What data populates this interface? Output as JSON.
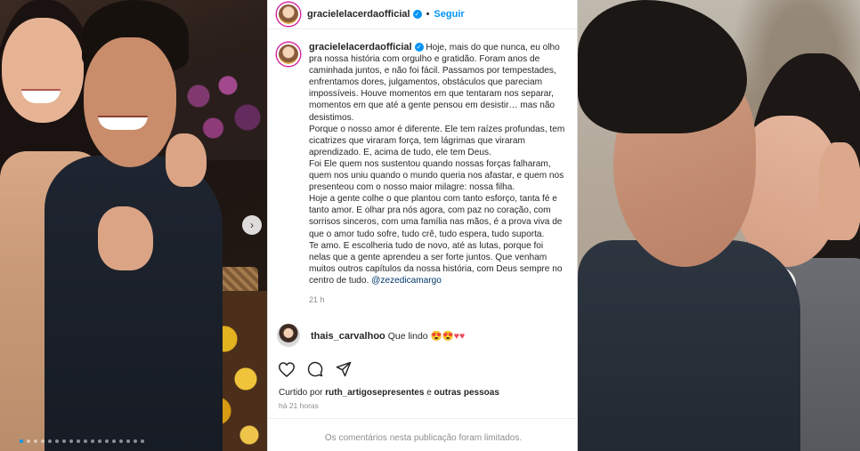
{
  "post": {
    "username": "gracielelacerdaofficial",
    "verified_badge": "✓",
    "separator": "•",
    "follow_label": "Seguir",
    "caption_paragraphs": [
      "Hoje, mais do que nunca, eu olho pra nossa história com orgulho e gratidão. Foram anos de caminhada juntos, e não foi fácil. Passamos por tempestades, enfrentamos dores, julgamentos, obstáculos que pareciam impossíveis. Houve momentos em que tentaram nos separar, momentos em que até a gente pensou em desistir… mas não desistimos.",
      "Porque o nosso amor é diferente. Ele tem raízes profundas, tem cicatrizes que viraram força, tem lágrimas que viraram aprendizado. E, acima de tudo, ele tem Deus.",
      "Foi Ele quem nos sustentou quando nossas forças falharam, quem nos uniu quando o mundo queria nos afastar, e quem nos presenteou com o nosso maior milagre: nossa filha.",
      "Hoje a gente colhe o que plantou com tanto esforço, tanta fé e tanto amor. E olhar pra nós agora, com paz no coração, com sorrisos sinceros, com uma família nas mãos, é a prova viva de que o amor tudo sofre, tudo crê, tudo espera, tudo suporta.",
      "Te amo. E escolheria tudo de novo, até as lutas, porque foi nelas que a gente aprendeu a ser forte juntos. Que venham muitos outros capítulos da nossa história, com Deus sempre no centro de tudo."
    ],
    "mention": "@zezedicamargo",
    "caption_time": "21 h",
    "comment": {
      "username": "thais_carvalhoo",
      "text": "Que lindo",
      "emojis": "😍😍",
      "hearts": "♥♥"
    },
    "liked_by": {
      "prefix": "Curtido por",
      "user": "ruth_artigosepresentes",
      "middle": "e",
      "others": "outras pessoas"
    },
    "post_time": "há 21 horas",
    "comments_limited": "Os comentários nesta publicação foram limitados."
  },
  "carousel": {
    "next_icon": "›",
    "total_dots": 18,
    "active_dot": 0
  },
  "colors": {
    "accent": "#0095f6",
    "heart": "#ed4956",
    "muted": "#8e8e8e",
    "text": "#262626"
  },
  "icons": {
    "like": "heart-outline-icon",
    "comment": "comment-bubble-icon",
    "share": "paper-plane-icon"
  }
}
